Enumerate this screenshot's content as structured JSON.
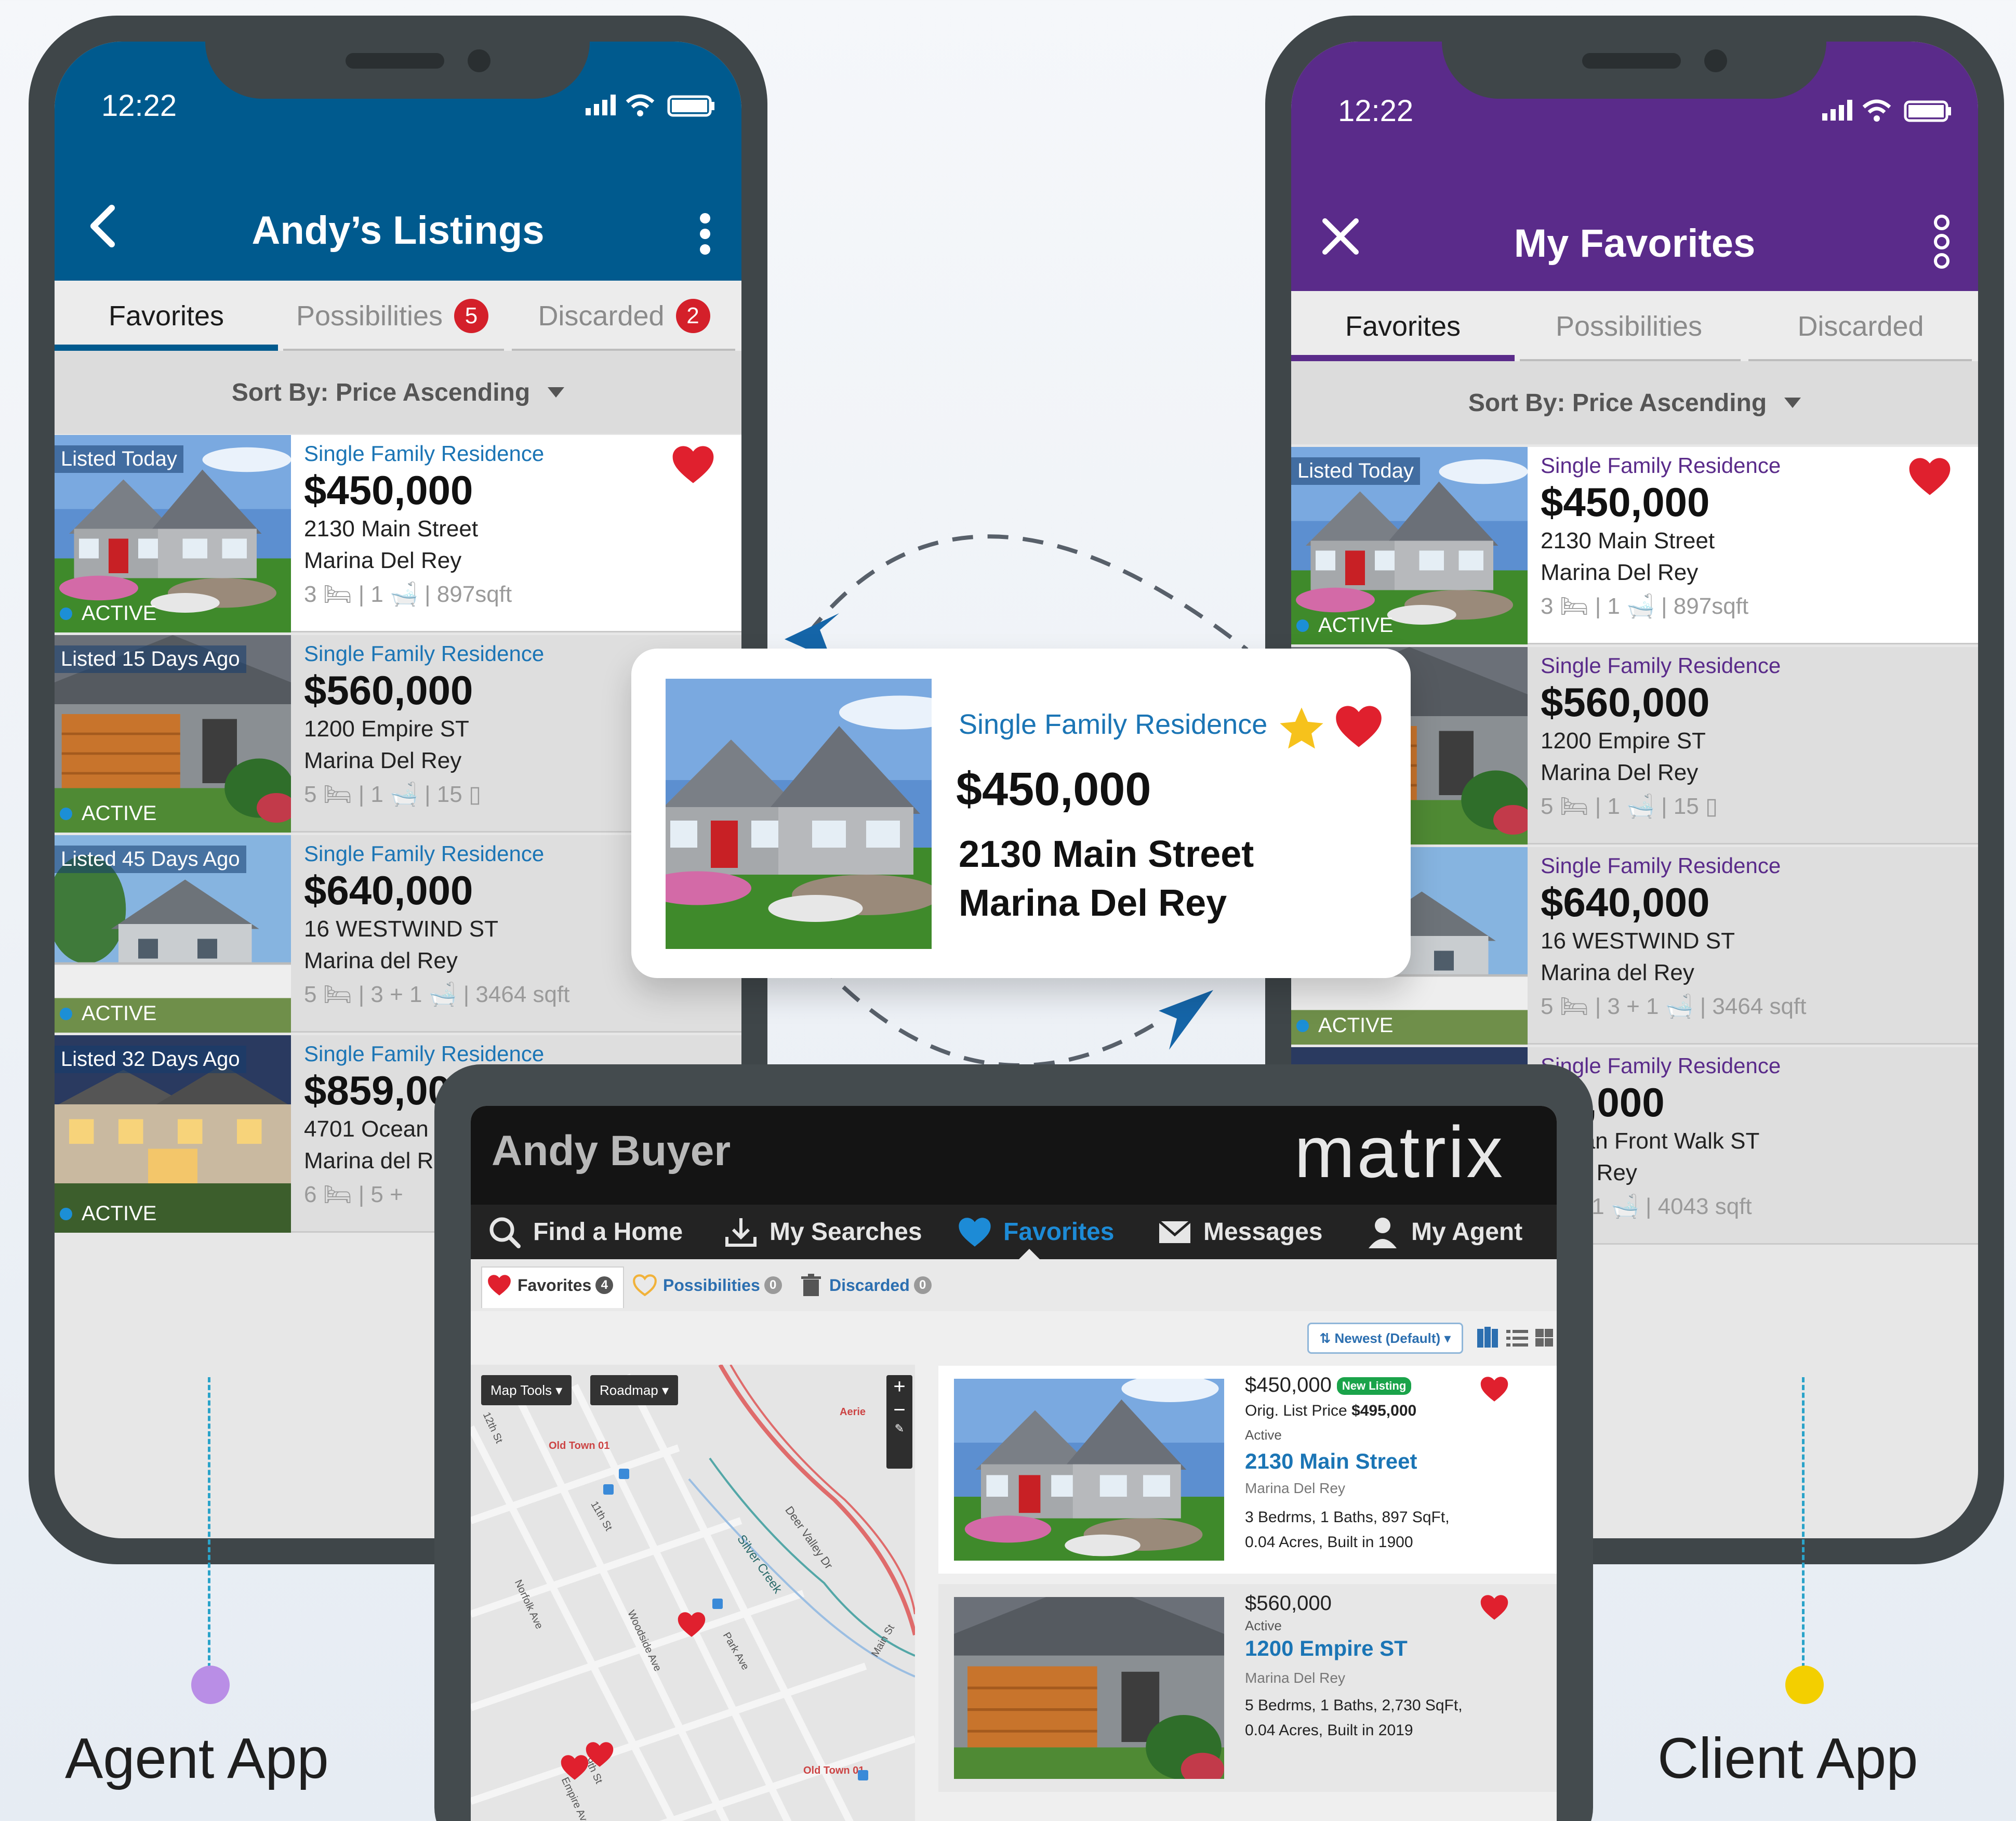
{
  "agent_app": {
    "time": "12:22",
    "title": "Andy’s Listings",
    "tabs": [
      {
        "label": "Favorites",
        "badge": ""
      },
      {
        "label": "Possibilities",
        "badge": "5"
      },
      {
        "label": "Discarded",
        "badge": "2"
      }
    ],
    "sort_label": "Sort By: Price Ascending",
    "listings": [
      {
        "tag": "Listed Today",
        "status": "ACTIVE",
        "type": "Single Family Residence",
        "price": "$450,000",
        "street": "2130 Main Street",
        "city": "Marina Del Rey",
        "meta": "3 🛏 | 1 🛁 | 897sqft"
      },
      {
        "tag": "Listed 15 Days Ago",
        "status": "ACTIVE",
        "type": "Single Family Residence",
        "price": "$560,000",
        "street": "1200 Empire ST",
        "city": "Marina Del Rey",
        "meta": "5 🛏 | 1 🛁 | 15 ▯"
      },
      {
        "tag": "Listed 45 Days Ago",
        "status": "ACTIVE",
        "type": "Single Family Residence",
        "price": "$640,000",
        "street": "16 WESTWIND ST",
        "city": "Marina del Rey",
        "meta": "5 🛏 | 3 + 1 🛁 | 3464 sqft"
      },
      {
        "tag": "Listed 32 Days Ago",
        "status": "ACTIVE",
        "type": "Single Family Residence",
        "price": "$859,00",
        "street": "4701 Ocean",
        "city": "Marina del R",
        "meta": "6 🛏 | 5 +"
      }
    ],
    "caption": "Agent App",
    "accent": "#005a8e"
  },
  "client_app": {
    "time": "12:22",
    "title": "My Favorites",
    "tabs": [
      {
        "label": "Favorites"
      },
      {
        "label": "Possibilities"
      },
      {
        "label": "Discarded"
      }
    ],
    "sort_label": "Sort By: Price Ascending",
    "listings": [
      {
        "tag": "Listed Today",
        "status": "ACTIVE",
        "type": "Single Family Residence",
        "price": "$450,000",
        "street": "2130 Main Street",
        "city": "Marina Del Rey",
        "meta": "3 🛏 | 1 🛁 | 897sqft"
      },
      {
        "tag": "s Ago",
        "status": "",
        "type": "Single Family Residence",
        "price": "$560,000",
        "street": "1200 Empire ST",
        "city": "Marina Del Rey",
        "meta": "5 🛏 | 1 🛁 | 15 ▯"
      },
      {
        "tag": "s Ago",
        "status": "ACTIVE",
        "type": "Single Family Residence",
        "price": "$640,000",
        "street": "16 WESTWIND ST",
        "city": "Marina del Rey",
        "meta": "5 🛏 | 3 + 1 🛁 | 3464 sqft"
      },
      {
        "tag": "",
        "status": "",
        "type": "Single Family Residence",
        "price": "59,000",
        "street": "Ocean Front Walk ST",
        "city": "a del Rey",
        "meta": "| 5 + 1 🛁 | 4043 sqft"
      }
    ],
    "caption": "Client App",
    "accent": "#5a2b8a"
  },
  "popup": {
    "type": "Single Family Residence",
    "price": "$450,000",
    "street": "2130 Main Street",
    "city": "Marina Del Rey"
  },
  "matrix": {
    "user": "Andy Buyer",
    "brand": "matrix",
    "nav": [
      "Find a Home",
      "My Searches",
      "Favorites",
      "Messages",
      "My Agent"
    ],
    "subtabs": [
      {
        "label": "Favorites",
        "count": "4"
      },
      {
        "label": "Possibilities",
        "count": "0"
      },
      {
        "label": "Discarded",
        "count": "0"
      }
    ],
    "sort_label": "⇅ Newest (Default) ▾",
    "map_tools": "Map Tools ▾",
    "roadmap": "Roadmap ▾",
    "map_labels": [
      "Old Town 01",
      "Silver Creek",
      "Deer Valley Dr",
      "Old Town 01",
      "Aerie",
      "11th St",
      "Park Ave",
      "Main St",
      "Norfolk Ave",
      "Woodside Ave",
      "Empire Ave",
      "9th St",
      "12th St"
    ],
    "cards": [
      {
        "price": "$450,000",
        "new_badge": "New Listing",
        "orig_label": "Orig. List Price",
        "orig_price": "$495,000",
        "status": "Active",
        "street": "2130 Main Street",
        "city": "Marina Del Rey",
        "specs": "3 Bedrms, 1 Baths, 897 SqFt,",
        "specs2": "0.04 Acres, Built in 1900"
      },
      {
        "price": "$560,000",
        "new_badge": "",
        "orig_label": "",
        "orig_price": "",
        "status": "Active",
        "street": "1200 Empire ST",
        "city": "Marina Del Rey",
        "specs": "5 Bedrms, 1 Baths, 2,730 SqFt,",
        "specs2": "0.04 Acres, Built in 2019"
      }
    ]
  },
  "colors": {
    "heart": "#e0202e",
    "star": "#f6c21c",
    "link_blue": "#1b75b5",
    "agent_dot": "#b98ee6",
    "client_dot": "#f3cf00"
  }
}
